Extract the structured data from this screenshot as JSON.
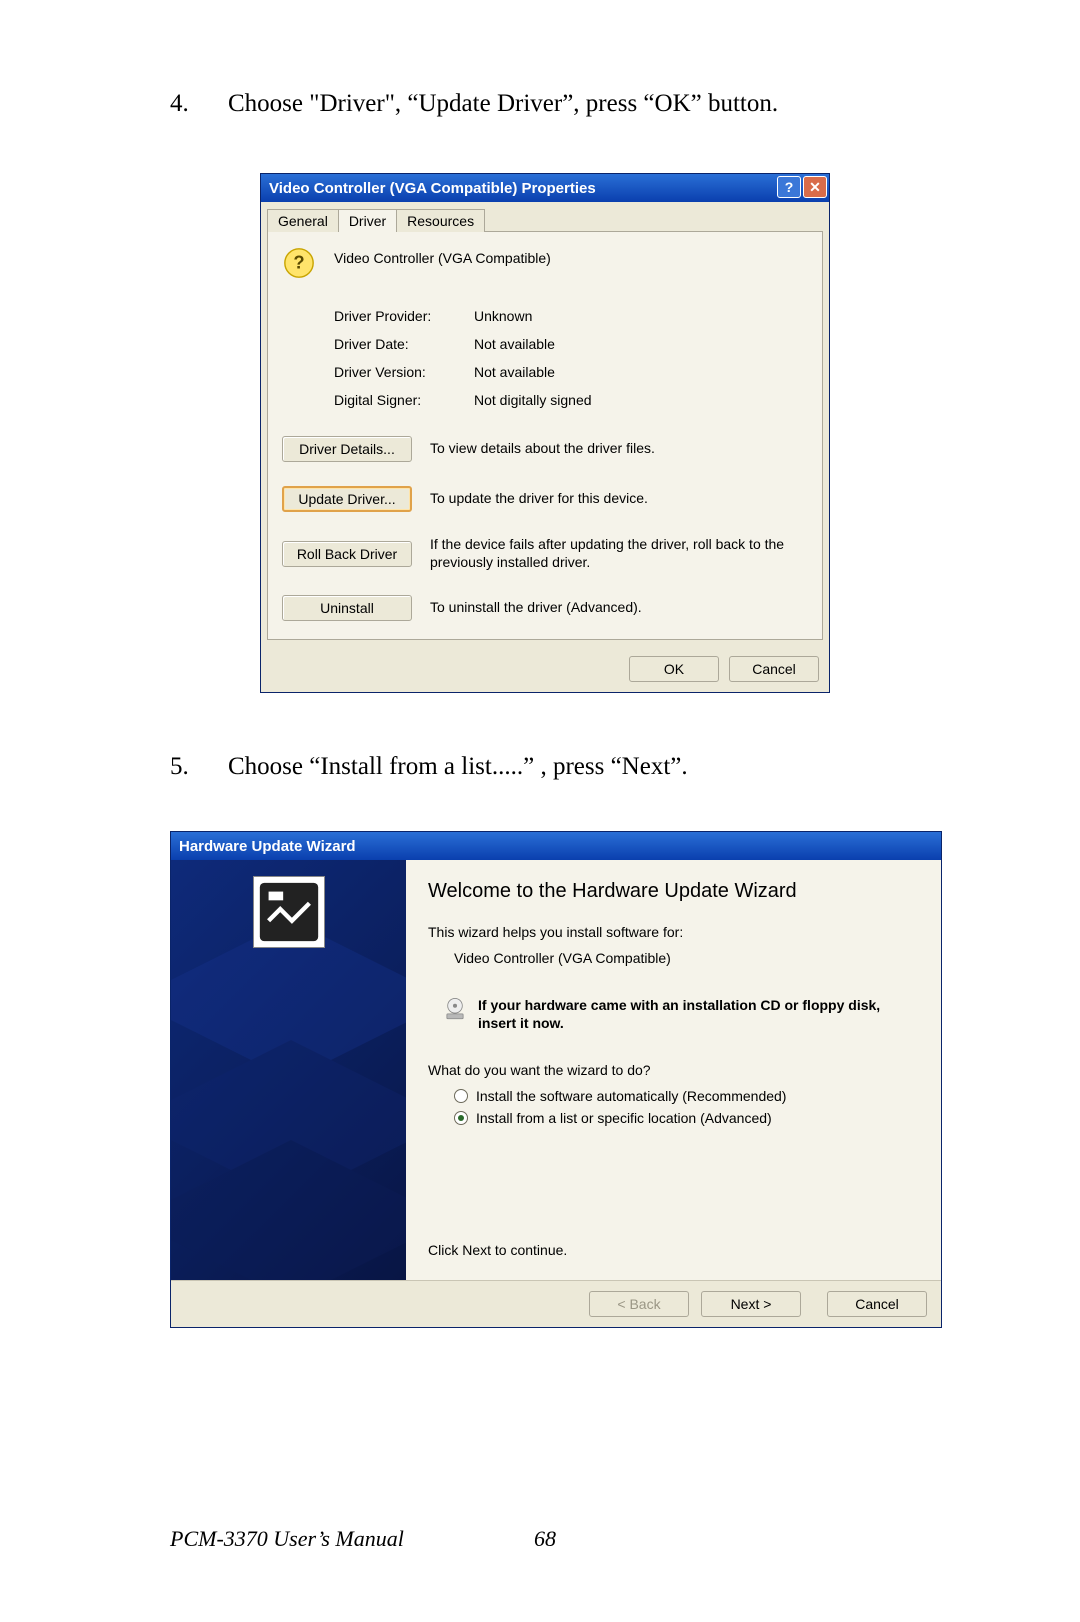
{
  "steps": {
    "s4_num": "4.",
    "s4_text": "Choose \"Driver\", “Update Driver”, press “OK” button.",
    "s5_num": "5.",
    "s5_text": "Choose “Install from a list.....” , press “Next”."
  },
  "dlg1": {
    "title": "Video Controller (VGA Compatible) Properties",
    "help_glyph": "?",
    "close_glyph": "✕",
    "tabs": {
      "general": "General",
      "driver": "Driver",
      "resources": "Resources"
    },
    "device_name": "Video Controller (VGA Compatible)",
    "props": {
      "provider_l": "Driver Provider:",
      "provider_v": "Unknown",
      "date_l": "Driver Date:",
      "date_v": "Not available",
      "version_l": "Driver Version:",
      "version_v": "Not available",
      "signer_l": "Digital Signer:",
      "signer_v": "Not digitally signed"
    },
    "buttons": {
      "details": {
        "label": "Driver Details...",
        "desc": "To view details about the driver files."
      },
      "update": {
        "label": "Update Driver...",
        "desc": "To update the driver for this device."
      },
      "rollback": {
        "label": "Roll Back Driver",
        "desc": "If the device fails after updating the driver, roll back to the previously installed driver."
      },
      "uninstall": {
        "label": "Uninstall",
        "desc": "To uninstall the driver (Advanced)."
      }
    },
    "ok": "OK",
    "cancel": "Cancel"
  },
  "dlg2": {
    "titlebar": "Hardware Update Wizard",
    "heading": "Welcome to the Hardware Update Wizard",
    "intro": "This wizard helps you install software for:",
    "device": "Video Controller (VGA Compatible)",
    "cd_notice": "If your hardware came with an installation CD or floppy disk, insert it now.",
    "question": "What do you want the wizard to do?",
    "opt_auto": "Install the software automatically (Recommended)",
    "opt_list": "Install from a list or specific location (Advanced)",
    "click_next": "Click Next to continue.",
    "back": "< Back",
    "next": "Next >",
    "cancel": "Cancel"
  },
  "footer": {
    "manual": "PCM-3370 User’s Manual",
    "page": "68"
  }
}
